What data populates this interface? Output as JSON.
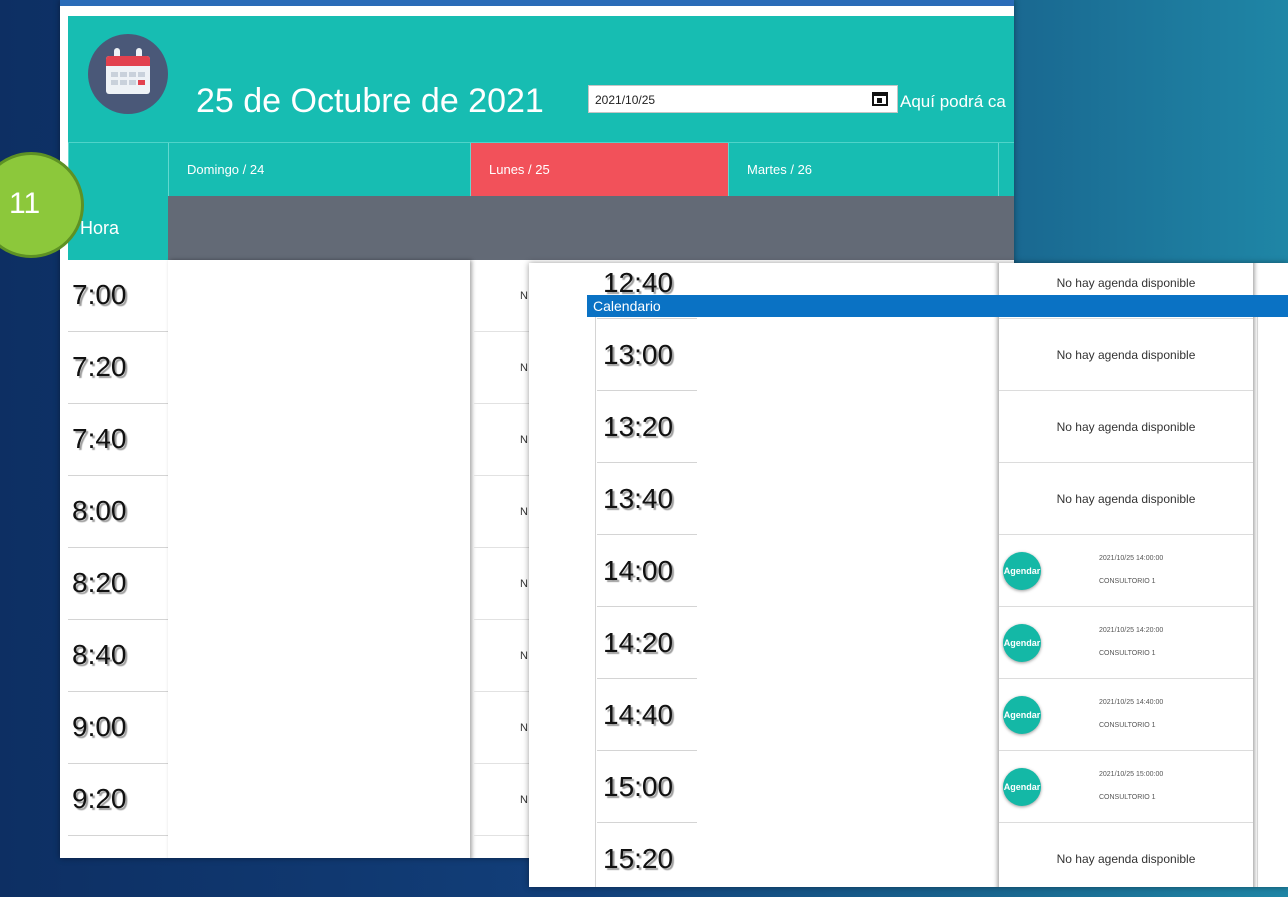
{
  "header": {
    "date_title": "25 de Octubre de 2021",
    "date_value": "2021/10/25",
    "hint": "Aquí podrá ca"
  },
  "days": [
    {
      "label": "Domingo / 24"
    },
    {
      "label": "Lunes / 25",
      "active": true
    },
    {
      "label": "Martes / 26"
    }
  ],
  "hour_label": "Hora",
  "badge": "11",
  "times": [
    "7:00",
    "7:20",
    "7:40",
    "8:00",
    "8:20",
    "8:40",
    "9:00",
    "9:20"
  ],
  "monday_partial": [
    "N",
    "N",
    "N",
    "N",
    "N",
    "N",
    "N",
    "N"
  ],
  "popup": {
    "title": "Calendario",
    "times": [
      "12:40",
      "13:00",
      "13:20",
      "13:40",
      "14:00",
      "14:20",
      "14:40",
      "15:00",
      "15:20"
    ],
    "slots": [
      {
        "type": "na",
        "text": "No hay agenda disponible"
      },
      {
        "type": "na",
        "text": "No hay agenda disponible"
      },
      {
        "type": "na",
        "text": "No hay agenda disponible"
      },
      {
        "type": "na",
        "text": "No hay agenda disponible"
      },
      {
        "type": "book",
        "button": "Agendar",
        "when": "2021/10/25 14:00:00",
        "where": "CONSULTORIO 1"
      },
      {
        "type": "book",
        "button": "Agendar",
        "when": "2021/10/25 14:20:00",
        "where": "CONSULTORIO 1"
      },
      {
        "type": "book",
        "button": "Agendar",
        "when": "2021/10/25 14:40:00",
        "where": "CONSULTORIO 1"
      },
      {
        "type": "book",
        "button": "Agendar",
        "when": "2021/10/25 15:00:00",
        "where": "CONSULTORIO 1"
      },
      {
        "type": "na",
        "text": "No hay agenda disponible"
      }
    ]
  },
  "colors": {
    "teal": "#17bdb2",
    "active_day": "#f2515a",
    "dark_row": "#636a76",
    "titlebar": "#0a72c4",
    "badge": "#8cc83b"
  }
}
